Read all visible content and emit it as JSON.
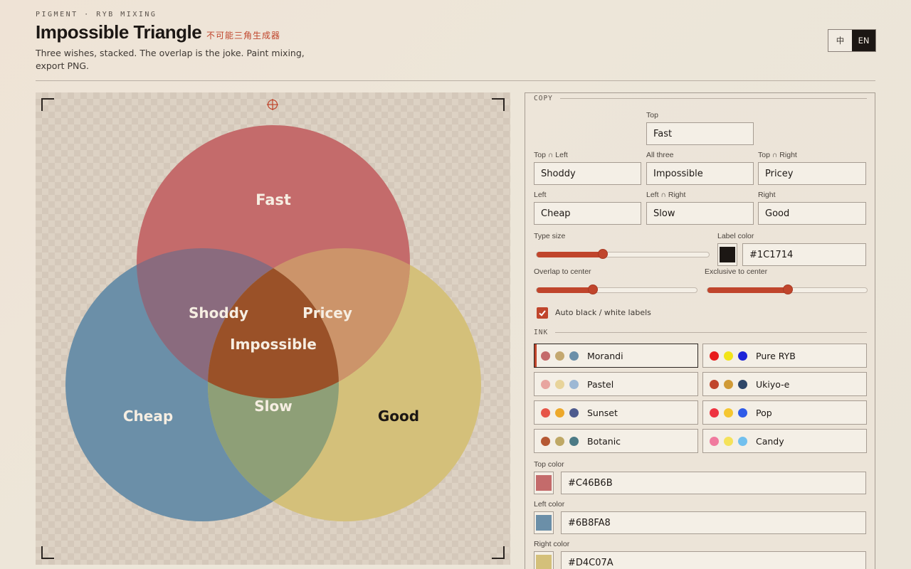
{
  "header": {
    "eyebrow": "PIGMENT · RYB MIXING",
    "title": "Impossible Triangle",
    "subtitle_cn": "不可能三角生成器",
    "tagline": "Three wishes, stacked. The overlap is the joke. Paint mixing, export PNG.",
    "lang_zh": "中",
    "lang_en": "EN",
    "active_lang": "EN"
  },
  "diagram": {
    "top_label": "Fast",
    "left_label": "Cheap",
    "right_label": "Good",
    "top_left_label": "Shoddy",
    "top_right_label": "Pricey",
    "left_right_label": "Slow",
    "center_label": "Impossible",
    "colors": {
      "top": "#C46B6B",
      "left": "#6B8FA8",
      "right": "#D4C07A",
      "top_left": "#8A6B7E",
      "top_right": "#CC946A",
      "left_right": "#8E9F77",
      "center": "#9A5128",
      "label_light": "#F6EEE2",
      "label_dark": "#1C1714"
    }
  },
  "panel": {
    "copy_section": "COPY",
    "fields": {
      "top": {
        "label": "Top",
        "value": "Fast"
      },
      "top_left": {
        "label": "Top ∩ Left",
        "value": "Shoddy"
      },
      "all_three": {
        "label": "All three",
        "value": "Impossible"
      },
      "top_right": {
        "label": "Top ∩ Right",
        "value": "Pricey"
      },
      "left": {
        "label": "Left",
        "value": "Cheap"
      },
      "left_right": {
        "label": "Left ∩ Right",
        "value": "Slow"
      },
      "right": {
        "label": "Right",
        "value": "Good"
      }
    },
    "type_size": {
      "label": "Type size",
      "level": 0.38
    },
    "label_color": {
      "label": "Label color",
      "value": "#1C1714"
    },
    "overlap_to_center": {
      "label": "Overlap to center",
      "level": 0.35
    },
    "exclusive_to_center": {
      "label": "Exclusive to center",
      "level": 0.5
    },
    "auto_labels": {
      "label": "Auto black / white labels",
      "checked": true
    },
    "ink_section": "INK",
    "inks": [
      {
        "name": "Morandi",
        "dots": [
          "#C46B6B",
          "#C4A870",
          "#6B8FA8"
        ],
        "active": true
      },
      {
        "name": "Pure RYB",
        "dots": [
          "#E81C1C",
          "#F2E418",
          "#1C23D8"
        ],
        "active": false
      },
      {
        "name": "Pastel",
        "dots": [
          "#E8A5A0",
          "#E8D49A",
          "#9DB8D4"
        ],
        "active": false
      },
      {
        "name": "Ukiyo-e",
        "dots": [
          "#C0452C",
          "#D09A36",
          "#2E4668"
        ],
        "active": false
      },
      {
        "name": "Sunset",
        "dots": [
          "#E65548",
          "#EDA82A",
          "#4E5B8E"
        ],
        "active": false
      },
      {
        "name": "Pop",
        "dots": [
          "#EE3340",
          "#F5C630",
          "#2F5BE8"
        ],
        "active": false
      },
      {
        "name": "Botanic",
        "dots": [
          "#B55833",
          "#BFA865",
          "#4C7A85"
        ],
        "active": false
      },
      {
        "name": "Candy",
        "dots": [
          "#F07A9E",
          "#F5E25A",
          "#72C0EE"
        ],
        "active": false
      }
    ],
    "top_color": {
      "label": "Top color",
      "value": "#C46B6B"
    },
    "left_color": {
      "label": "Left color",
      "value": "#6B8FA8"
    },
    "right_color": {
      "label": "Right color",
      "value": "#D4C07A"
    }
  }
}
